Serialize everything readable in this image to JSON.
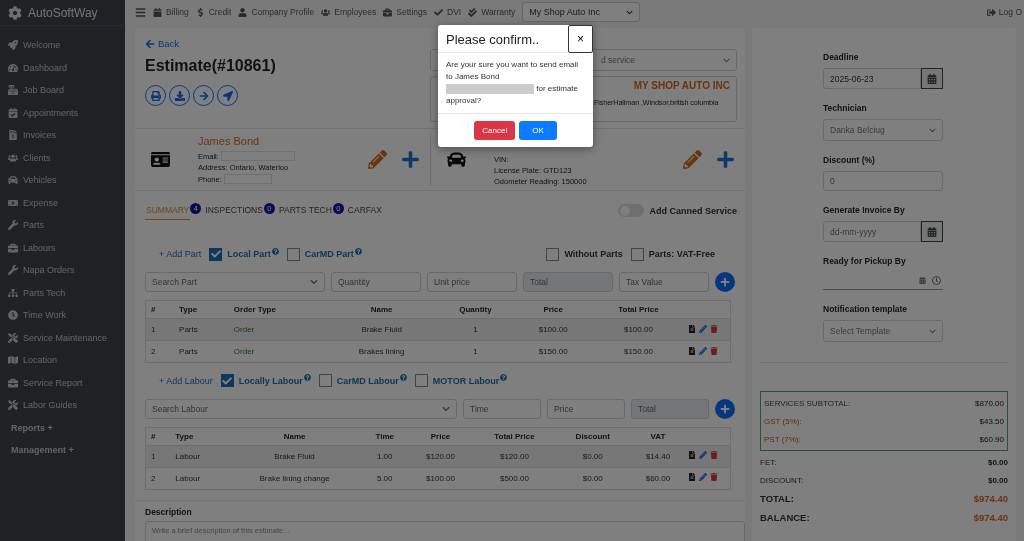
{
  "sidebar": {
    "brand": "AutoSoftWay",
    "items": [
      {
        "label": "Welcome",
        "kind": "link"
      },
      {
        "label": "Dashboard",
        "kind": "link"
      },
      {
        "label": "Job Board",
        "kind": "link"
      },
      {
        "label": "Appointments",
        "kind": "link"
      },
      {
        "label": "Invoices",
        "kind": "link"
      },
      {
        "label": "Clients",
        "kind": "link"
      },
      {
        "label": "Vehicles",
        "kind": "link"
      },
      {
        "label": "Expense",
        "kind": "link"
      },
      {
        "label": "Parts",
        "kind": "link"
      },
      {
        "label": "Labours",
        "kind": "link"
      },
      {
        "label": "Napa Orders",
        "kind": "link"
      },
      {
        "label": "Parts Tech",
        "kind": "link"
      },
      {
        "label": "Time Work",
        "kind": "link"
      },
      {
        "label": "Service Maintenance",
        "kind": "link"
      },
      {
        "label": "Location",
        "kind": "link"
      },
      {
        "label": "Service Report",
        "kind": "link"
      },
      {
        "label": "Labor Guides",
        "kind": "link"
      },
      {
        "label": "Reports +",
        "kind": "section"
      },
      {
        "label": "Management +",
        "kind": "section"
      }
    ]
  },
  "topbar": {
    "items": [
      "Billing",
      "Credit",
      "Company Profile",
      "Employees",
      "Settings",
      "DVI",
      "Warranty"
    ],
    "shop_select": "My Shop Auto Inc",
    "logout": "Log O"
  },
  "estimate": {
    "back": "Back",
    "title": "Estimate(#10861)",
    "service_select": "d service",
    "shop_name": "MY SHOP AUTO INC",
    "shop_address": "FisherHallman ,Windsor,british columbia"
  },
  "client": {
    "name": "James Bond",
    "email_label": "Email:",
    "address": "Address: Ontario, Waterloo",
    "phone_label": "Phone:"
  },
  "vehicle": {
    "vin": "VIN:",
    "plate": "License Plate: GTD123",
    "odometer": "Odometer Reading: 150000"
  },
  "tabs": [
    {
      "label": "SUMMARY",
      "badge": "4",
      "selected": true
    },
    {
      "label": "INSPECTIONS",
      "badge": "0",
      "selected": false
    },
    {
      "label": "PARTS TECH",
      "badge": "0",
      "selected": false
    },
    {
      "label": "CARFAX",
      "selected": false
    }
  ],
  "canned_toggle": {
    "label": "Add Canned Service",
    "on": false
  },
  "parts": {
    "add": "+ Add Part",
    "options": [
      {
        "label": "Local Part",
        "checked": true
      },
      {
        "label": "CarMD Part",
        "checked": false
      }
    ],
    "extra_options": [
      {
        "label": "Without Parts",
        "checked": false
      },
      {
        "label": "Parts: VAT-Free",
        "checked": false
      }
    ],
    "inputs": [
      {
        "placeholder": "Search Part",
        "kind": "select"
      },
      {
        "placeholder": "Quantity",
        "kind": "input"
      },
      {
        "placeholder": "Unit price",
        "kind": "input"
      },
      {
        "placeholder": "Total",
        "kind": "readonly"
      },
      {
        "placeholder": "Tax Value",
        "kind": "input"
      }
    ],
    "columns": [
      {
        "label": "#"
      },
      {
        "label": "Type"
      },
      {
        "label": "Order Type",
        "kind": "status"
      },
      {
        "label": "Name"
      },
      {
        "label": "Quantity"
      },
      {
        "label": "Price"
      },
      {
        "label": "Total Price"
      }
    ],
    "rows": [
      [
        "1",
        "Parts",
        "Order",
        "Brake Fluid",
        "1",
        "$100.00",
        "$100.00"
      ],
      [
        "2",
        "Parts",
        "Order",
        "Brakes lining",
        "1",
        "$150.00",
        "$150.00"
      ]
    ]
  },
  "labour": {
    "add": "+ Add Labour",
    "options": [
      {
        "label": "Locally Labour",
        "checked": true
      },
      {
        "label": "CarMD Labour",
        "checked": false
      },
      {
        "label": "MOTOR Labour",
        "checked": false
      }
    ],
    "inputs": [
      {
        "placeholder": "Search Labour",
        "kind": "select"
      },
      {
        "placeholder": "Time",
        "kind": "input"
      },
      {
        "placeholder": "Price",
        "kind": "input"
      },
      {
        "placeholder": "Total",
        "kind": "readonly"
      }
    ],
    "columns": [
      {
        "label": "#"
      },
      {
        "label": "Type"
      },
      {
        "label": "Name"
      },
      {
        "label": "Time"
      },
      {
        "label": "Price"
      },
      {
        "label": "Total Price"
      },
      {
        "label": "Discount"
      },
      {
        "label": "VAT"
      }
    ],
    "rows": [
      [
        "1",
        "Labour",
        "Brake Fluid",
        "1.00",
        "$120.00",
        "$120.00",
        "$0.00",
        "$14.40"
      ],
      [
        "2",
        "Labour",
        "Brake lining change",
        "5.00",
        "$100.00",
        "$500.00",
        "$0.00",
        "$60.00"
      ]
    ]
  },
  "description": {
    "label": "Description",
    "placeholder": "Write a brief description of this estimate..."
  },
  "side_fields": [
    {
      "label": "Deadline",
      "kind": "date",
      "value": "2025-06-23"
    },
    {
      "label": "Technician",
      "kind": "select",
      "value": "Danka  Belciug"
    },
    {
      "label": "Discount (%)",
      "kind": "input",
      "value": "0"
    },
    {
      "label": "Generate Invoice By",
      "kind": "date",
      "placeholder": "dd-mm-yyyy"
    },
    {
      "label": "Ready for Pickup By",
      "kind": "datetime"
    },
    {
      "label": "Notification template",
      "kind": "select",
      "value": "Select Template"
    }
  ],
  "summary_box": [
    {
      "label": "SERVICES SUBTOTAL:",
      "value": "$870.00",
      "accent": false
    },
    {
      "label": "GST (5%):",
      "value": "$43.50",
      "accent": true
    },
    {
      "label": "PST (7%):",
      "value": "$60.90",
      "accent": true
    }
  ],
  "totals": [
    {
      "label": "FET:",
      "value": "$0.00",
      "kind": "plain"
    },
    {
      "label": "DISCOUNT:",
      "value": "$0.00",
      "kind": "plain"
    },
    {
      "label": "TOTAL:",
      "value": "$974.40",
      "kind": "grand"
    },
    {
      "label": "BALANCE:",
      "value": "$974.40",
      "kind": "grand"
    }
  ],
  "modal": {
    "title": "Please confirm..",
    "close": "×",
    "message_start": "Are your sure you want to send email to James Bond",
    "message_end": "for estimate approval?",
    "buttons": [
      {
        "label": "Cancel",
        "kind": "danger"
      },
      {
        "label": "OK",
        "kind": "primary"
      }
    ]
  }
}
